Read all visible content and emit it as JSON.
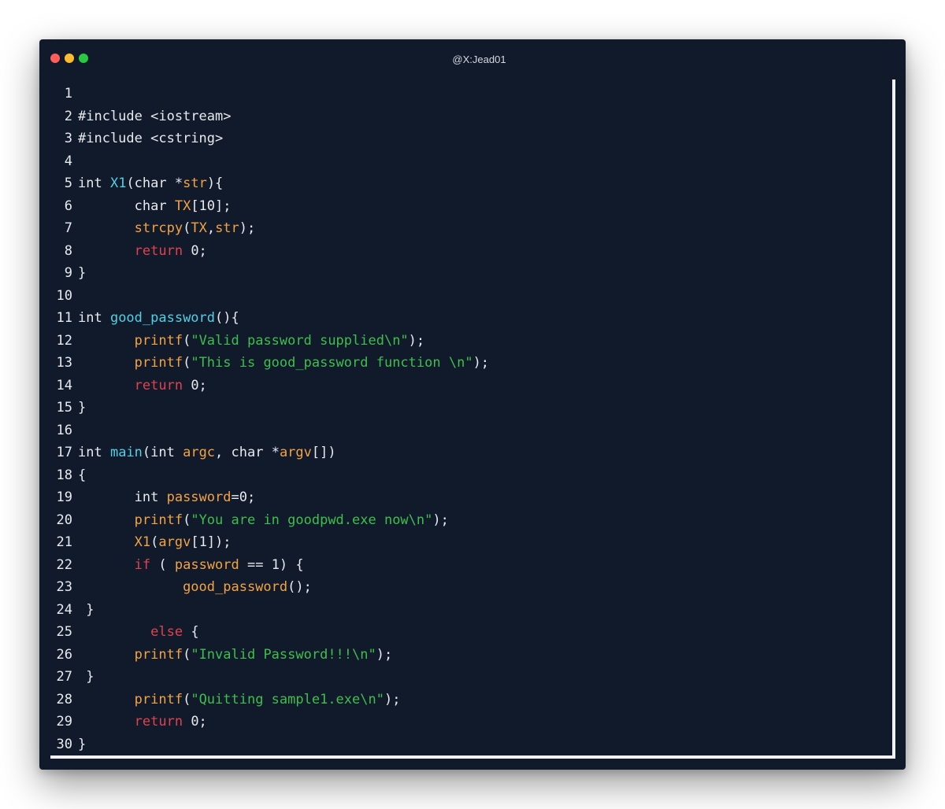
{
  "window": {
    "title": "@X:Jead01"
  },
  "lines": [
    {
      "n": "1",
      "tokens": []
    },
    {
      "n": "2",
      "tokens": [
        {
          "t": "#include <iostream>",
          "c": "tx"
        }
      ]
    },
    {
      "n": "3",
      "tokens": [
        {
          "t": "#include <cstring>",
          "c": "tx"
        }
      ]
    },
    {
      "n": "4",
      "tokens": []
    },
    {
      "n": "5",
      "tokens": [
        {
          "t": "int ",
          "c": "tx"
        },
        {
          "t": "X1",
          "c": "fn"
        },
        {
          "t": "(char *",
          "c": "tx"
        },
        {
          "t": "str",
          "c": "id"
        },
        {
          "t": "){",
          "c": "tx"
        }
      ]
    },
    {
      "n": "6",
      "tokens": [
        {
          "t": "       char ",
          "c": "tx"
        },
        {
          "t": "TX",
          "c": "id"
        },
        {
          "t": "[10];",
          "c": "tx"
        }
      ]
    },
    {
      "n": "7",
      "tokens": [
        {
          "t": "       ",
          "c": "tx"
        },
        {
          "t": "strcpy",
          "c": "id"
        },
        {
          "t": "(",
          "c": "tx"
        },
        {
          "t": "TX",
          "c": "id"
        },
        {
          "t": ",",
          "c": "tx"
        },
        {
          "t": "str",
          "c": "id"
        },
        {
          "t": ");",
          "c": "tx"
        }
      ]
    },
    {
      "n": "8",
      "tokens": [
        {
          "t": "       ",
          "c": "tx"
        },
        {
          "t": "return",
          "c": "kw"
        },
        {
          "t": " 0;",
          "c": "tx"
        }
      ]
    },
    {
      "n": "9",
      "tokens": [
        {
          "t": "}",
          "c": "tx"
        }
      ]
    },
    {
      "n": "10",
      "tokens": []
    },
    {
      "n": "11",
      "tokens": [
        {
          "t": "int ",
          "c": "tx"
        },
        {
          "t": "good_password",
          "c": "fn"
        },
        {
          "t": "(){",
          "c": "tx"
        }
      ]
    },
    {
      "n": "12",
      "tokens": [
        {
          "t": "       ",
          "c": "tx"
        },
        {
          "t": "printf",
          "c": "id"
        },
        {
          "t": "(",
          "c": "tx"
        },
        {
          "t": "\"Valid password supplied\\n\"",
          "c": "st"
        },
        {
          "t": ");",
          "c": "tx"
        }
      ]
    },
    {
      "n": "13",
      "tokens": [
        {
          "t": "       ",
          "c": "tx"
        },
        {
          "t": "printf",
          "c": "id"
        },
        {
          "t": "(",
          "c": "tx"
        },
        {
          "t": "\"This is good_password function \\n\"",
          "c": "st"
        },
        {
          "t": ");",
          "c": "tx"
        }
      ]
    },
    {
      "n": "14",
      "tokens": [
        {
          "t": "       ",
          "c": "tx"
        },
        {
          "t": "return",
          "c": "kw"
        },
        {
          "t": " 0;",
          "c": "tx"
        }
      ]
    },
    {
      "n": "15",
      "tokens": [
        {
          "t": "}",
          "c": "tx"
        }
      ]
    },
    {
      "n": "16",
      "tokens": []
    },
    {
      "n": "17",
      "tokens": [
        {
          "t": "int ",
          "c": "tx"
        },
        {
          "t": "main",
          "c": "fn"
        },
        {
          "t": "(int ",
          "c": "tx"
        },
        {
          "t": "argc",
          "c": "id"
        },
        {
          "t": ", char *",
          "c": "tx"
        },
        {
          "t": "argv",
          "c": "id"
        },
        {
          "t": "[])",
          "c": "tx"
        }
      ]
    },
    {
      "n": "18",
      "tokens": [
        {
          "t": "{",
          "c": "tx"
        }
      ]
    },
    {
      "n": "19",
      "tokens": [
        {
          "t": "       int ",
          "c": "tx"
        },
        {
          "t": "password",
          "c": "id"
        },
        {
          "t": "=0;",
          "c": "tx"
        }
      ]
    },
    {
      "n": "20",
      "tokens": [
        {
          "t": "       ",
          "c": "tx"
        },
        {
          "t": "printf",
          "c": "id"
        },
        {
          "t": "(",
          "c": "tx"
        },
        {
          "t": "\"You are in goodpwd.exe now\\n\"",
          "c": "st"
        },
        {
          "t": ");",
          "c": "tx"
        }
      ]
    },
    {
      "n": "21",
      "tokens": [
        {
          "t": "       ",
          "c": "tx"
        },
        {
          "t": "X1",
          "c": "id"
        },
        {
          "t": "(",
          "c": "tx"
        },
        {
          "t": "argv",
          "c": "id"
        },
        {
          "t": "[1]);",
          "c": "tx"
        }
      ]
    },
    {
      "n": "22",
      "tokens": [
        {
          "t": "       ",
          "c": "tx"
        },
        {
          "t": "if",
          "c": "kw"
        },
        {
          "t": " ( ",
          "c": "tx"
        },
        {
          "t": "password",
          "c": "id"
        },
        {
          "t": " == 1) {",
          "c": "tx"
        }
      ]
    },
    {
      "n": "23",
      "tokens": [
        {
          "t": "             ",
          "c": "tx"
        },
        {
          "t": "good_password",
          "c": "id"
        },
        {
          "t": "();",
          "c": "tx"
        }
      ]
    },
    {
      "n": "24",
      "tokens": [
        {
          "t": " }",
          "c": "tx"
        }
      ]
    },
    {
      "n": "25",
      "tokens": [
        {
          "t": "         ",
          "c": "tx"
        },
        {
          "t": "else",
          "c": "kw"
        },
        {
          "t": " {",
          "c": "tx"
        }
      ]
    },
    {
      "n": "26",
      "tokens": [
        {
          "t": "       ",
          "c": "tx"
        },
        {
          "t": "printf",
          "c": "id"
        },
        {
          "t": "(",
          "c": "tx"
        },
        {
          "t": "\"Invalid Password!!!\\n\"",
          "c": "st"
        },
        {
          "t": ");",
          "c": "tx"
        }
      ]
    },
    {
      "n": "27",
      "tokens": [
        {
          "t": " }",
          "c": "tx"
        }
      ]
    },
    {
      "n": "28",
      "tokens": [
        {
          "t": "       ",
          "c": "tx"
        },
        {
          "t": "printf",
          "c": "id"
        },
        {
          "t": "(",
          "c": "tx"
        },
        {
          "t": "\"Quitting sample1.exe\\n\"",
          "c": "st"
        },
        {
          "t": ");",
          "c": "tx"
        }
      ]
    },
    {
      "n": "29",
      "tokens": [
        {
          "t": "       ",
          "c": "tx"
        },
        {
          "t": "return",
          "c": "kw"
        },
        {
          "t": " 0;",
          "c": "tx"
        }
      ]
    },
    {
      "n": "30",
      "tokens": [
        {
          "t": "}",
          "c": "tx"
        }
      ]
    }
  ]
}
